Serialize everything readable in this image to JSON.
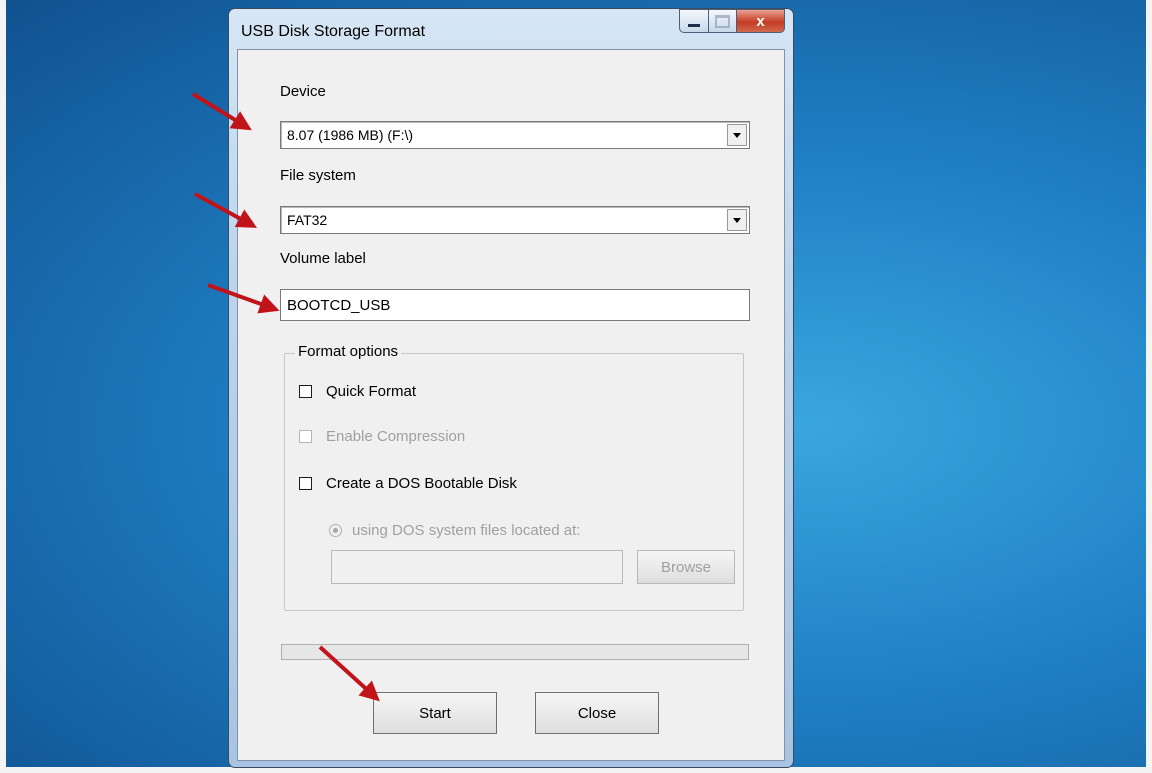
{
  "window": {
    "title": "USB Disk Storage Format",
    "close_glyph": "x"
  },
  "device": {
    "label": "Device",
    "selected": "8.07 (1986 MB) (F:\\)"
  },
  "file_system": {
    "label": "File system",
    "selected": "FAT32"
  },
  "volume_label": {
    "label": "Volume label",
    "value": "BOOTCD_USB"
  },
  "format_options": {
    "legend": "Format options",
    "quick_format": {
      "label": "Quick Format",
      "checked": false
    },
    "enable_compression": {
      "label": "Enable Compression",
      "checked": false,
      "disabled": true
    },
    "dos_bootable": {
      "label": "Create a DOS Bootable Disk",
      "checked": false
    },
    "dos_files_option": {
      "label": "using DOS system files located at:",
      "disabled": true
    },
    "dos_path": {
      "value": ""
    },
    "browse_label": "Browse"
  },
  "progress": {
    "value": 0
  },
  "buttons": {
    "start": "Start",
    "close": "Close"
  },
  "colors": {
    "annotation_arrow": "#c0141a",
    "desktop": "#1f7fc4"
  },
  "icons": [
    "minimize-icon",
    "maximize-icon",
    "close-icon",
    "dropdown-arrow-icon",
    "annotation-arrow-icon"
  ]
}
